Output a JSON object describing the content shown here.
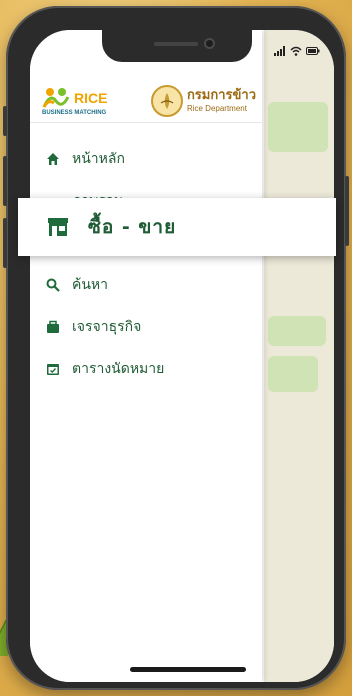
{
  "brand": {
    "rice_word": "RICE",
    "rice_subtitle": "BUSINESS MATCHING",
    "dept_name_th": "กรมการข้าว",
    "dept_name_en": "Rice Department"
  },
  "colors": {
    "primary_green": "#1f5c35",
    "rice_orange": "#f0a400",
    "dept_gold": "#9c6b14"
  },
  "menu": {
    "items": [
      {
        "label": "หน้าหลัก",
        "icon": "home-icon"
      },
      {
        "label": "ภาพรวม",
        "icon": "dashboard-icon"
      },
      {
        "label": "ค้นหา",
        "icon": "search-icon"
      },
      {
        "label": "เจรจาธุรกิจ",
        "icon": "briefcase-icon"
      },
      {
        "label": "ตารางนัดหมาย",
        "icon": "calendar-icon"
      }
    ],
    "active": {
      "label": "ซื้อ - ขาย",
      "icon": "store-icon"
    }
  }
}
